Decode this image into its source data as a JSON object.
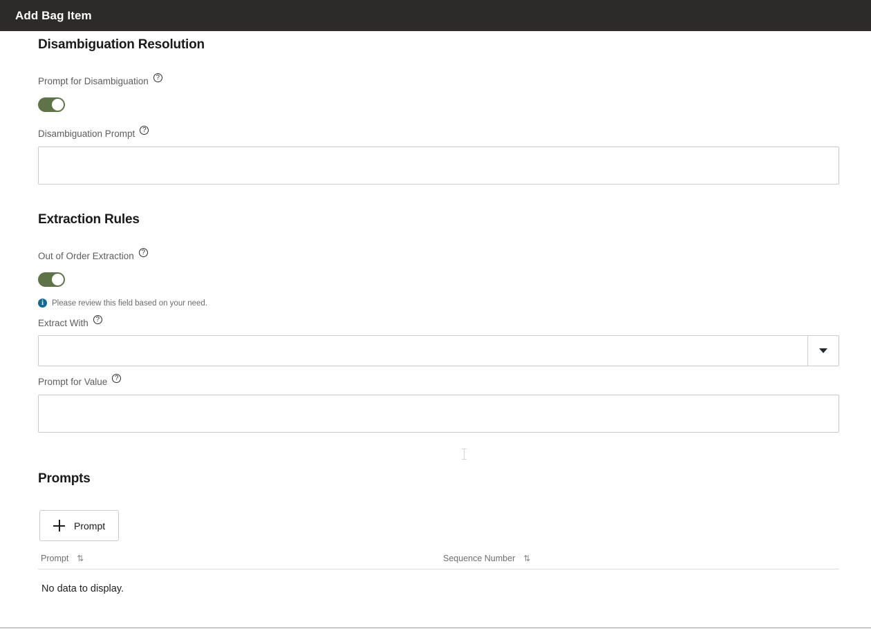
{
  "window": {
    "title": "Add Bag Item",
    "header_bg": "#2e2a27"
  },
  "colors": {
    "toggle_on": "#5f7349",
    "info_icon": "#15688f",
    "border": "#c8c8c8",
    "label_text": "#5c5c5c",
    "heading_text": "#1a1a1a"
  },
  "sections": {
    "disambiguation": {
      "title": "Disambiguation Resolution",
      "prompt_for_disambiguation": {
        "label": "Prompt for Disambiguation",
        "help": "?",
        "toggle_state": "on"
      },
      "disambiguation_prompt": {
        "label": "Disambiguation Prompt",
        "help": "?",
        "value": "",
        "placeholder": ""
      }
    },
    "extraction_rules": {
      "title": "Extraction Rules",
      "out_of_order_extraction": {
        "label": "Out of Order Extraction",
        "help": "?",
        "toggle_state": "on"
      },
      "info_message": {
        "icon": "i",
        "text": "Please review this field based on your need."
      },
      "extract_with": {
        "label": "Extract With",
        "help": "?",
        "value": "",
        "placeholder": "",
        "caret": "chevron-down"
      },
      "prompt_for_value": {
        "label": "Prompt for Value",
        "help": "?",
        "value": "",
        "placeholder": ""
      }
    },
    "prompts": {
      "title": "Prompts",
      "add_button": {
        "label": "Prompt",
        "icon": "plus-icon"
      },
      "table": {
        "columns": [
          {
            "label": "Prompt",
            "sort": "⇅"
          },
          {
            "label": "Sequence Number",
            "sort": "⇅"
          }
        ],
        "empty_text": "No data to display.",
        "rows": []
      }
    }
  }
}
